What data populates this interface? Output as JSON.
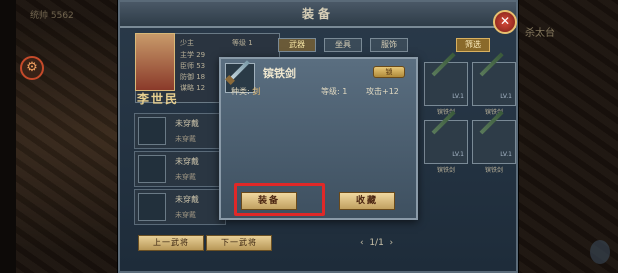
{
  "window": {
    "title": "装备",
    "close_label": "✕"
  },
  "hero": {
    "name": "李世民",
    "title_label": "少主",
    "level": "等级 1",
    "rows": [
      "主学 29",
      "臣师 53",
      "防御 18",
      "谋略 12",
      "魅力 39"
    ]
  },
  "tabs": [
    "武器",
    "坐具",
    "服饰"
  ],
  "filter_label": "筛选",
  "slots": [
    {
      "label": "未穿戴",
      "sub": "未穿戴"
    },
    {
      "label": "未穿戴",
      "sub": "未穿戴"
    },
    {
      "label": "未穿戴",
      "sub": "未穿戴"
    }
  ],
  "nav": {
    "prev": "上一武将",
    "next": "下一武将"
  },
  "inventory_items": [
    {
      "name": "镔铁剑",
      "lv": "LV.1"
    },
    {
      "name": "镔铁剑",
      "lv": "LV.1"
    },
    {
      "name": "镔铁剑",
      "lv": "LV.1"
    },
    {
      "name": "镔铁剑",
      "lv": "LV.1"
    }
  ],
  "pager": "1/1",
  "popup": {
    "name": "镔铁剑",
    "lock_label": "锁",
    "type_label": "种类:",
    "type_value": "剑",
    "level_label": "等级:",
    "level_value": "1",
    "attack": "攻击+12",
    "equip_label": "装备",
    "collect_label": "收藏"
  },
  "bg_texts": {
    "tl": "统帅 5562",
    "tr": "杀太台"
  }
}
